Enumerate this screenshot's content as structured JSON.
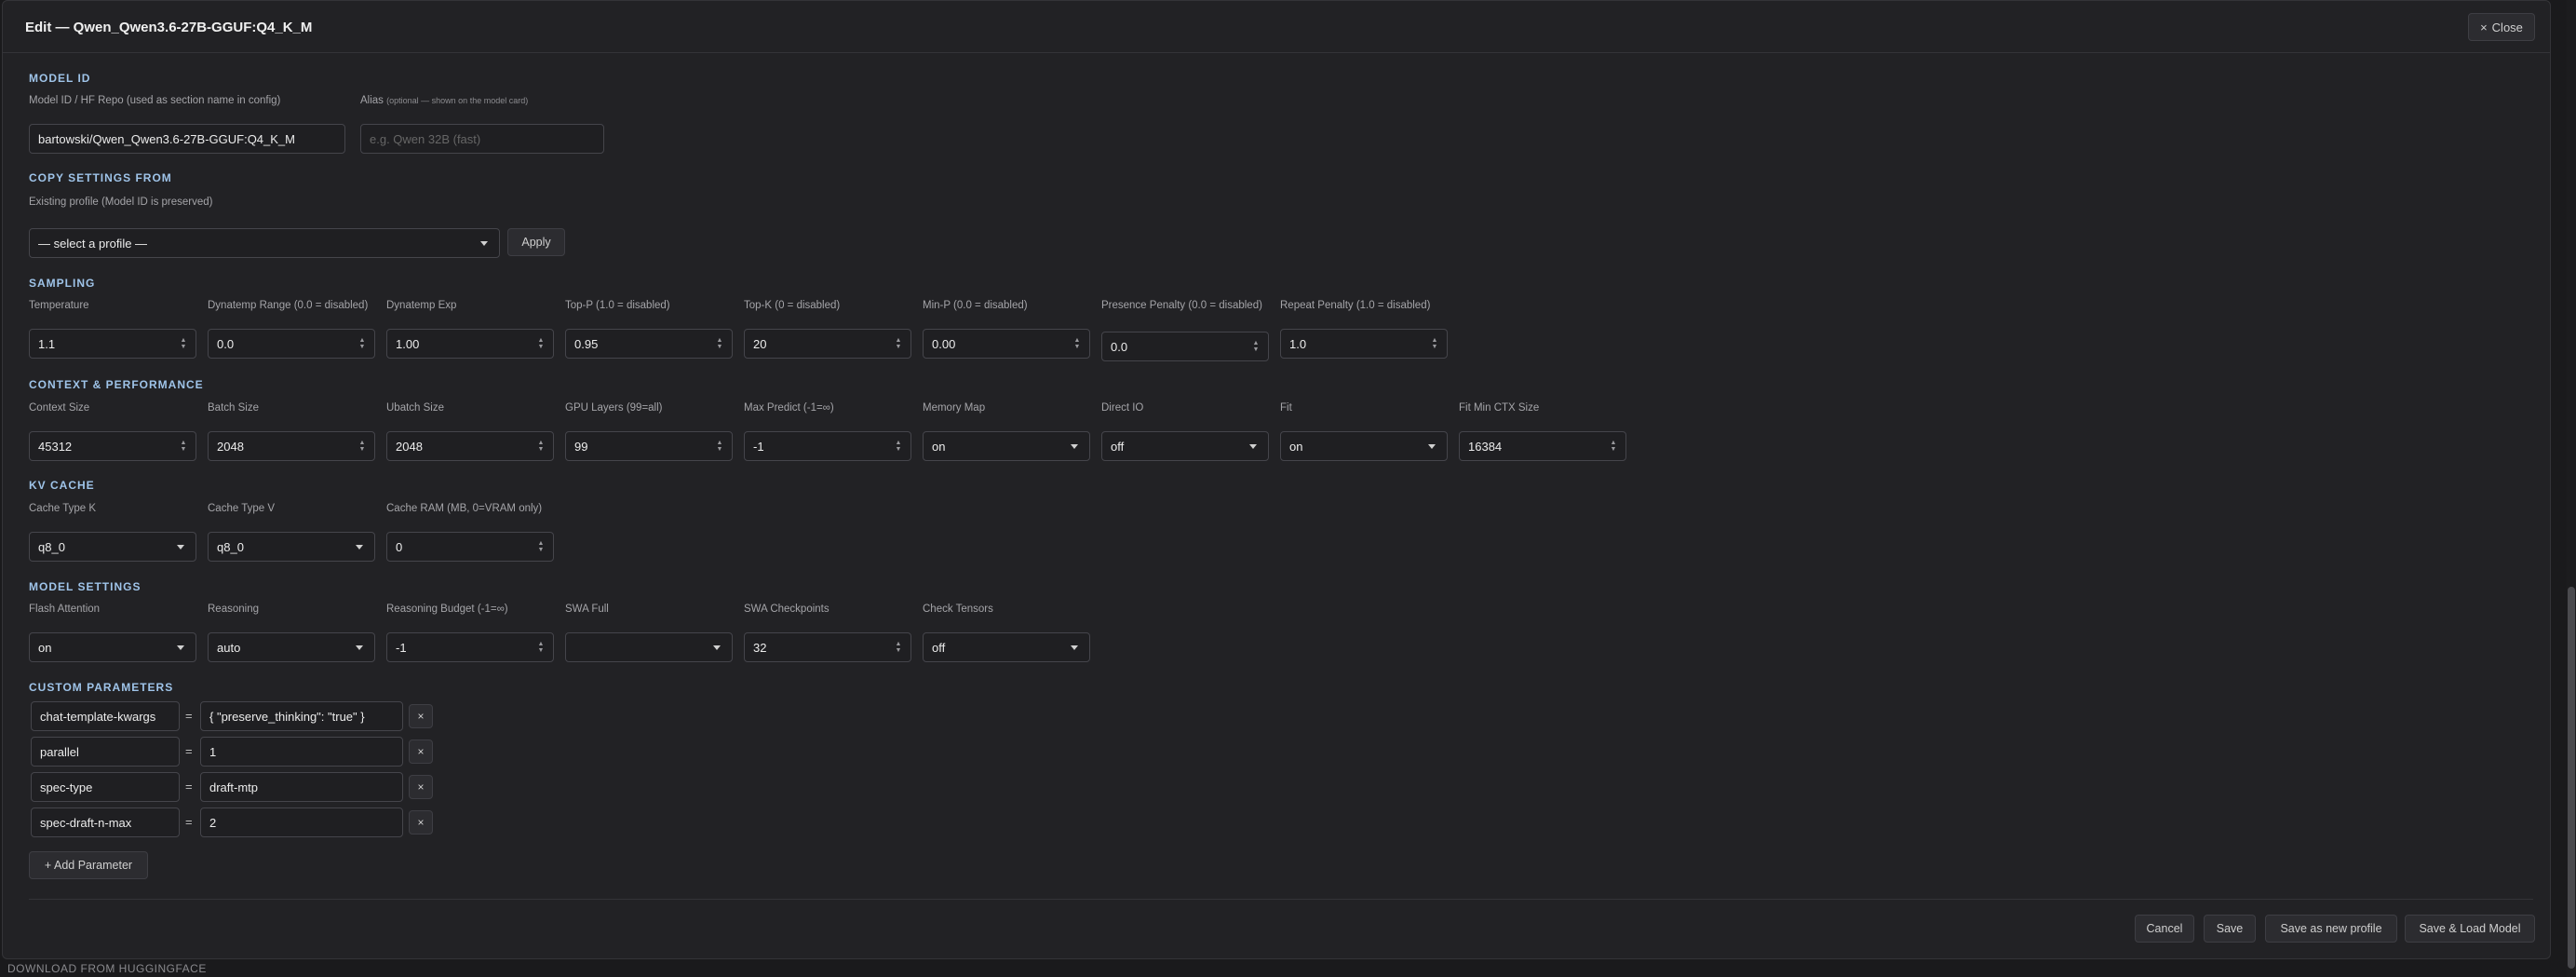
{
  "dialog": {
    "title": "Edit — Qwen_Qwen3.6-27B-GGUF:Q4_K_M",
    "close_label": "Close",
    "close_glyph": "×"
  },
  "model_id": {
    "section": "MODEL ID",
    "repo_label": "Model ID / HF Repo (used as section name in config)",
    "repo_value": "bartowski/Qwen_Qwen3.6-27B-GGUF:Q4_K_M",
    "alias_label": "Alias",
    "alias_hint": "(optional — shown on the model card)",
    "alias_placeholder": "e.g. Qwen 32B (fast)"
  },
  "copy_settings": {
    "section": "COPY SETTINGS FROM",
    "label": "Existing profile (Model ID is preserved)",
    "select_value": "— select a profile —",
    "apply_label": "Apply"
  },
  "sampling": {
    "section": "SAMPLING",
    "fields": [
      {
        "label": "Temperature",
        "value": "1.1"
      },
      {
        "label": "Dynatemp Range (0.0 = disabled)",
        "value": "0.0"
      },
      {
        "label": "Dynatemp Exp",
        "value": "1.00"
      },
      {
        "label": "Top-P (1.0 = disabled)",
        "value": "0.95"
      },
      {
        "label": "Top-K (0 = disabled)",
        "value": "20"
      },
      {
        "label": "Min-P (0.0 = disabled)",
        "value": "0.00"
      },
      {
        "label": "Presence Penalty (0.0 = disabled)",
        "value": "0.0"
      },
      {
        "label": "Repeat Penalty (1.0 = disabled)",
        "value": "1.0"
      }
    ]
  },
  "context": {
    "section": "CONTEXT & PERFORMANCE",
    "fields": [
      {
        "label": "Context Size",
        "value": "45312"
      },
      {
        "label": "Batch Size",
        "value": "2048"
      },
      {
        "label": "Ubatch Size",
        "value": "2048"
      },
      {
        "label": "GPU Layers (99=all)",
        "value": "99"
      },
      {
        "label": "Max Predict (-1=∞)",
        "value": "-1"
      },
      {
        "label": "Memory Map",
        "value": "on"
      },
      {
        "label": "Direct IO",
        "value": "off"
      },
      {
        "label": "Fit",
        "value": "on"
      },
      {
        "label": "Fit Min CTX Size",
        "value": "16384"
      }
    ]
  },
  "kv_cache": {
    "section": "KV CACHE",
    "fields": [
      {
        "label": "Cache Type K",
        "value": "q8_0"
      },
      {
        "label": "Cache Type V",
        "value": "q8_0"
      },
      {
        "label": "Cache RAM (MB, 0=VRAM only)",
        "value": "0"
      }
    ]
  },
  "model_settings": {
    "section": "MODEL SETTINGS",
    "fields": [
      {
        "label": "Flash Attention",
        "value": "on"
      },
      {
        "label": "Reasoning",
        "value": "auto"
      },
      {
        "label": "Reasoning Budget (-1=∞)",
        "value": "-1"
      },
      {
        "label": "SWA Full",
        "value": ""
      },
      {
        "label": "SWA Checkpoints",
        "value": "32"
      },
      {
        "label": "Check Tensors",
        "value": "off"
      }
    ]
  },
  "custom": {
    "section": "CUSTOM PARAMETERS",
    "eq": "=",
    "remove_glyph": "×",
    "params": [
      {
        "key": "chat-template-kwargs",
        "value": "{ \"preserve_thinking\": \"true\" }"
      },
      {
        "key": "parallel",
        "value": "1"
      },
      {
        "key": "spec-type",
        "value": "draft-mtp"
      },
      {
        "key": "spec-draft-n-max",
        "value": "2"
      }
    ],
    "add_label": "+ Add Parameter"
  },
  "footer": {
    "cancel": "Cancel",
    "save": "Save",
    "save_new": "Save as new profile",
    "save_load": "Save & Load Model"
  },
  "bottom_label": "DOWNLOAD FROM HUGGINGFACE"
}
